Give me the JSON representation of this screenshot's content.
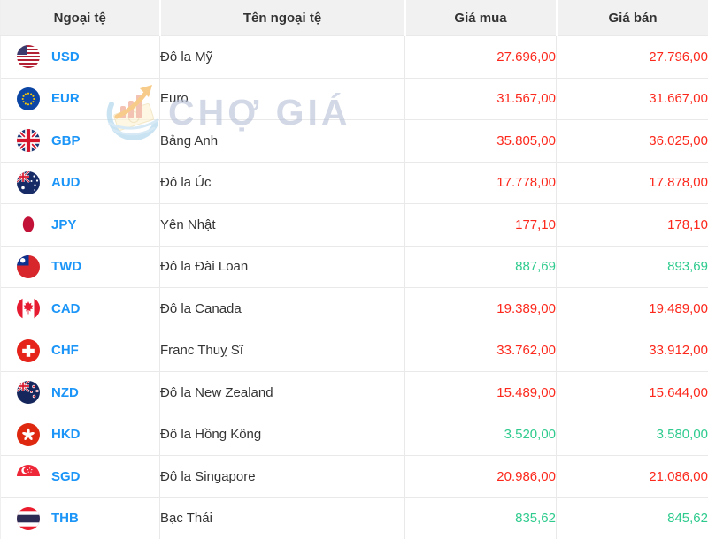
{
  "watermark": {
    "text": "CHỢ GIÁ",
    "logo_icon": "cho-gia-logo-icon"
  },
  "colors": {
    "price_down_red": "#fc281c",
    "price_up_green": "#2fcb8e",
    "currency_code_blue": "#1b95f7",
    "header_bg": "#f1f1f1",
    "header_text": "#333333",
    "row_border": "#e9e9e9"
  },
  "table": {
    "columns": [
      {
        "key": "code",
        "label": "Ngoại tệ"
      },
      {
        "key": "name",
        "label": "Tên ngoại tệ"
      },
      {
        "key": "buy",
        "label": "Giá mua"
      },
      {
        "key": "sell",
        "label": "Giá bán"
      }
    ],
    "rows": [
      {
        "code": "USD",
        "flag_icon": "usd-flag-icon",
        "name": "Đô la Mỹ",
        "buy": "27.696,00",
        "sell": "27.796,00",
        "price_color": "red"
      },
      {
        "code": "EUR",
        "flag_icon": "eur-flag-icon",
        "name": "Euro",
        "buy": "31.567,00",
        "sell": "31.667,00",
        "price_color": "red"
      },
      {
        "code": "GBP",
        "flag_icon": "gbp-flag-icon",
        "name": "Bảng Anh",
        "buy": "35.805,00",
        "sell": "36.025,00",
        "price_color": "red"
      },
      {
        "code": "AUD",
        "flag_icon": "aud-flag-icon",
        "name": "Đô la Úc",
        "buy": "17.778,00",
        "sell": "17.878,00",
        "price_color": "red"
      },
      {
        "code": "JPY",
        "flag_icon": "jpy-flag-icon",
        "name": "Yên Nhật",
        "buy": "177,10",
        "sell": "178,10",
        "price_color": "red"
      },
      {
        "code": "TWD",
        "flag_icon": "twd-flag-icon",
        "name": "Đô la Đài Loan",
        "buy": "887,69",
        "sell": "893,69",
        "price_color": "green"
      },
      {
        "code": "CAD",
        "flag_icon": "cad-flag-icon",
        "name": "Đô la Canada",
        "buy": "19.389,00",
        "sell": "19.489,00",
        "price_color": "red"
      },
      {
        "code": "CHF",
        "flag_icon": "chf-flag-icon",
        "name": "Franc Thuỵ Sĩ",
        "buy": "33.762,00",
        "sell": "33.912,00",
        "price_color": "red"
      },
      {
        "code": "NZD",
        "flag_icon": "nzd-flag-icon",
        "name": "Đô la New Zealand",
        "buy": "15.489,00",
        "sell": "15.644,00",
        "price_color": "red"
      },
      {
        "code": "HKD",
        "flag_icon": "hkd-flag-icon",
        "name": "Đô la Hồng Kông",
        "buy": "3.520,00",
        "sell": "3.580,00",
        "price_color": "green"
      },
      {
        "code": "SGD",
        "flag_icon": "sgd-flag-icon",
        "name": "Đô la Singapore",
        "buy": "20.986,00",
        "sell": "21.086,00",
        "price_color": "red"
      },
      {
        "code": "THB",
        "flag_icon": "thb-flag-icon",
        "name": "Bạc Thái",
        "buy": "835,62",
        "sell": "845,62",
        "price_color": "green"
      }
    ]
  }
}
